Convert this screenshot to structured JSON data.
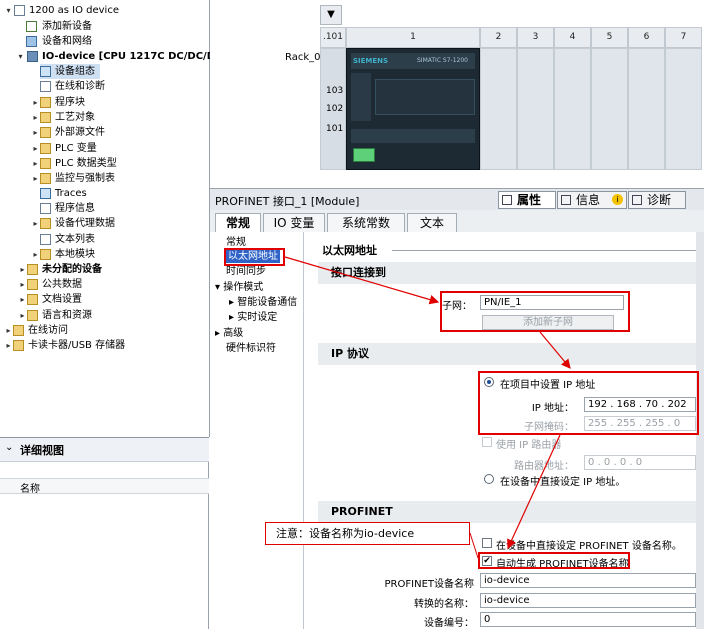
{
  "tree": {
    "project": "1200 as IO device",
    "items": [
      {
        "label": "添加新设备"
      },
      {
        "label": "设备和网络"
      },
      {
        "label": "IO-device [CPU 1217C DC/DC/DC]"
      },
      {
        "label": "设备组态"
      },
      {
        "label": "在线和诊断"
      },
      {
        "label": "程序块"
      },
      {
        "label": "工艺对象"
      },
      {
        "label": "外部源文件"
      },
      {
        "label": "PLC 变量"
      },
      {
        "label": "PLC 数据类型"
      },
      {
        "label": "监控与强制表"
      },
      {
        "label": "Traces"
      },
      {
        "label": "程序信息"
      },
      {
        "label": "设备代理数据"
      },
      {
        "label": "文本列表"
      },
      {
        "label": "本地模块"
      },
      {
        "label": "未分配的设备"
      },
      {
        "label": "公共数据"
      },
      {
        "label": "文档设置"
      },
      {
        "label": "语言和资源"
      },
      {
        "label": "在线访问"
      },
      {
        "label": "卡读卡器/USB 存储器"
      }
    ]
  },
  "detail_view": {
    "title": "详细视图",
    "column": "名称"
  },
  "device_view": {
    "rack_label": "Rack_0",
    "slot_headers": [
      ".101",
      "1",
      "2",
      "3",
      "4",
      "5",
      "6",
      "7"
    ],
    "row_labels": [
      "103",
      "102",
      "101"
    ],
    "plc_brand": "SIEMENS",
    "plc_model": "SIMATIC S7-1200"
  },
  "properties": {
    "title": "PROFINET 接口_1 [Module]",
    "right_tabs": [
      "属性",
      "信息",
      "诊断"
    ],
    "tabs": [
      "常规",
      "IO 变量",
      "系统常数",
      "文本"
    ],
    "nav": [
      "常规",
      "以太网地址",
      "时间同步",
      "操作模式",
      "智能设备通信",
      "实时设定",
      "高级",
      "硬件标识符"
    ],
    "page_title": "以太网地址",
    "interface_section": "接口连接到",
    "subnet_label": "子网：",
    "subnet_value": "PN/IE_1",
    "add_subnet": "添加新子网",
    "ip_section": "IP 协议",
    "ip_in_project": "在项目中设置 IP 地址",
    "ip_label": "IP 地址：",
    "ip_value": [
      "192",
      "168",
      "70",
      "202"
    ],
    "mask_label": "子网掩码：",
    "mask_value": [
      "255",
      "255",
      "255",
      "0"
    ],
    "use_router": "使用 IP 路由器",
    "router_label": "路由器地址：",
    "router_value": [
      "0",
      "0",
      "0",
      "0"
    ],
    "ip_direct": "在设备中直接设定 IP 地址。",
    "profinet_section": "PROFINET",
    "pn_direct": "在设备中直接设定 PROFINET 设备名称。",
    "pn_auto": "自动生成 PROFINET设备名称",
    "pn_name_label": "PROFINET设备名称",
    "pn_name_value": "io-device",
    "conv_label": "转换的名称：",
    "conv_value": "io-device",
    "devnum_label": "设备编号：",
    "devnum_value": "0"
  },
  "annotation": "注意：设备名称为io-device",
  "colors": {
    "highlight": "#e00000",
    "selection": "#cfe0f3",
    "section": "#e9ecef"
  }
}
